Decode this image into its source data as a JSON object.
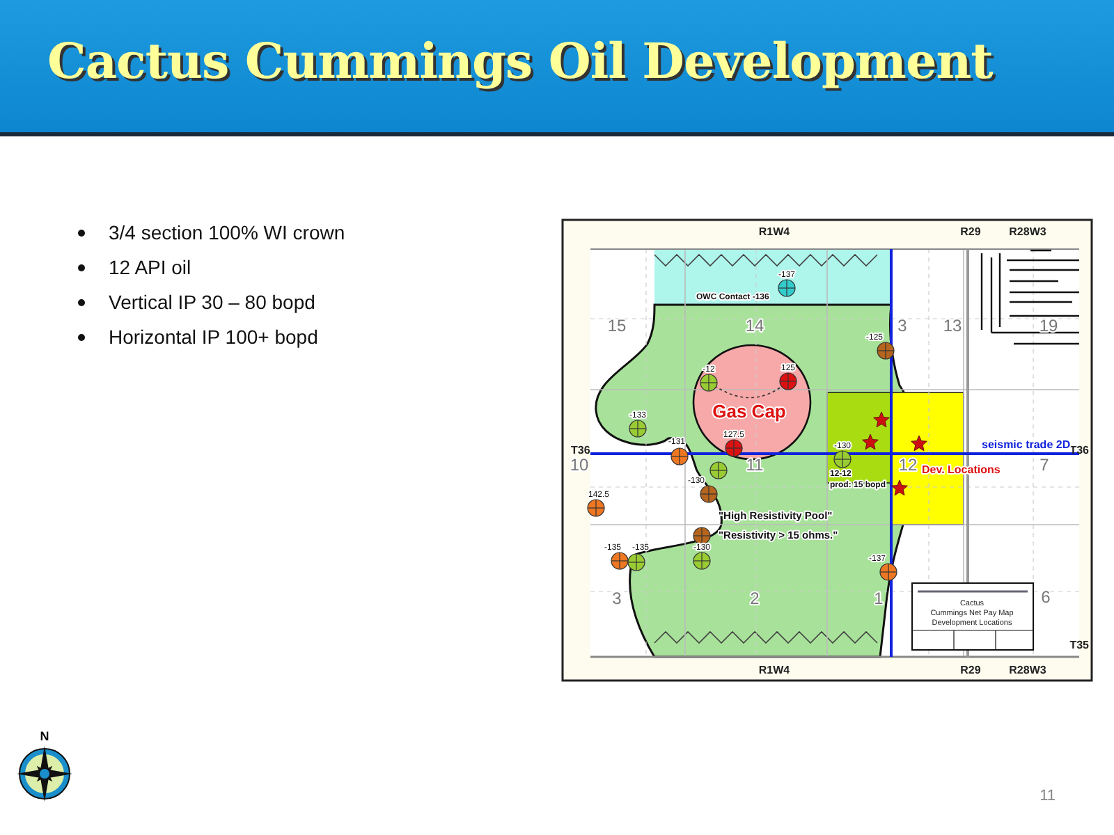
{
  "title": "Cactus Cummings Oil Development",
  "bullets": [
    "3/4 section 100% WI crown",
    "12 API oil",
    "Vertical IP 30 – 80 bopd",
    "Horizontal IP 100+ bopd"
  ],
  "map": {
    "range_labels_top": [
      "R1W4",
      "R29",
      "R28W3"
    ],
    "range_labels_bottom": [
      "R1W4",
      "R29",
      "R28W3"
    ],
    "township_labels": [
      "T36",
      "T36",
      "T35"
    ],
    "section_numbers": [
      "15",
      "14",
      "3",
      "13",
      "19",
      "10",
      "11",
      "12",
      "7",
      "3",
      "2",
      "1",
      "6"
    ],
    "wells": [
      {
        "label": "-137",
        "color": "#33cccc"
      },
      {
        "label": "-125",
        "color": "#b5651d"
      },
      {
        "label": "-12",
        "color": "#99cc33"
      },
      {
        "label": "125",
        "color": "#dd1111"
      },
      {
        "label": "-133",
        "color": "#99cc33"
      },
      {
        "label": "127.5",
        "color": "#dd1111"
      },
      {
        "label": "-131",
        "color": "#ee7722"
      },
      {
        "color": "#99cc33"
      },
      {
        "label": "-130",
        "color": "#99cc33"
      },
      {
        "label": "-130",
        "color": "#b5651d"
      },
      {
        "label": "142.5",
        "color": "#ee7722"
      },
      {
        "color": "#b5651d"
      },
      {
        "label": "-135",
        "color": "#ee7722"
      },
      {
        "label": "-135",
        "color": "#99cc33"
      },
      {
        "label": "-130",
        "color": "#99cc33"
      },
      {
        "label": "-137",
        "color": "#ee7722"
      }
    ],
    "annotations": [
      {
        "kind": "note",
        "text": "OWC Contact -136"
      },
      {
        "kind": "zone",
        "text": "Gas Cap"
      },
      {
        "kind": "note",
        "text": "12-12"
      },
      {
        "kind": "note",
        "text": "prod: 15 bopd"
      },
      {
        "kind": "pool",
        "text": "\"High Resistivity Pool\""
      },
      {
        "kind": "pool",
        "text": "\"Resistivity > 15 ohms.\""
      },
      {
        "kind": "seismic",
        "text": "seismic trade 2D"
      },
      {
        "kind": "dev",
        "text": "Dev. Locations"
      }
    ],
    "title_block": [
      "Cactus",
      "Cummings Net Pay Map",
      "Development Locations"
    ]
  },
  "compass_label": "N",
  "page_number": "11"
}
